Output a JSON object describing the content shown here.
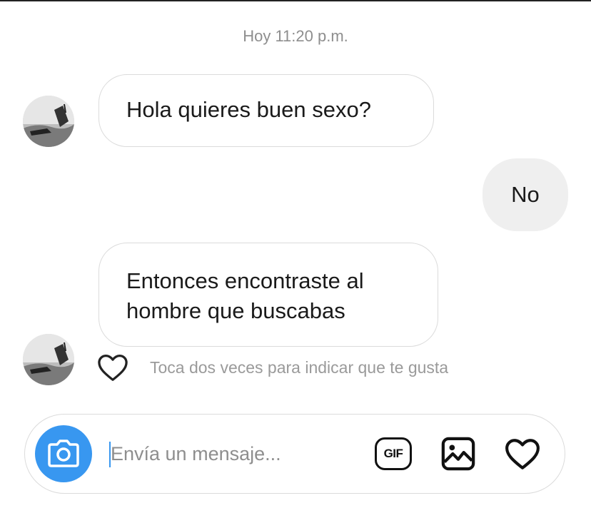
{
  "conversation": {
    "timestamp": "Hoy 11:20 p.m.",
    "messages": [
      {
        "sender": "other",
        "text": "Hola quieres buen sexo?"
      },
      {
        "sender": "me",
        "text": "No"
      },
      {
        "sender": "other",
        "lines": [
          "Entonces encontraste al",
          "hombre que buscabas"
        ]
      }
    ],
    "like_hint": "Toca dos veces para indicar que te gusta"
  },
  "composer": {
    "placeholder": "Envía un mensaje...",
    "gif_label": "GIF",
    "icons": [
      "camera-icon",
      "gif-icon",
      "image-icon",
      "heart-icon"
    ]
  },
  "colors": {
    "accent": "#3897f0",
    "incoming_border": "#dbdbdb",
    "outgoing_bg": "#efefef",
    "muted_text": "#8e8e8e"
  }
}
